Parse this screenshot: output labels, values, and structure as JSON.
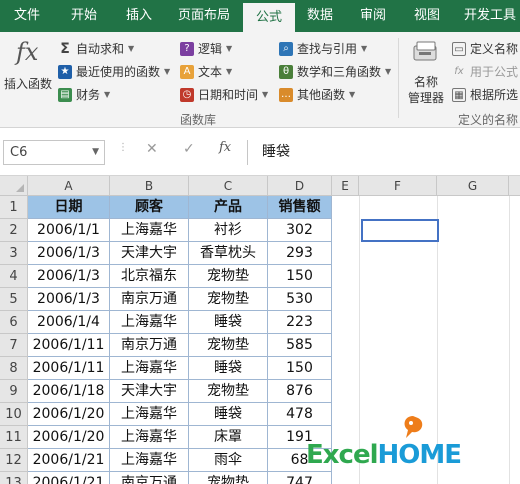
{
  "tabs": [
    {
      "label": "文件"
    },
    {
      "label": "开始"
    },
    {
      "label": "插入"
    },
    {
      "label": "页面布局"
    },
    {
      "label": "公式"
    },
    {
      "label": "数据"
    },
    {
      "label": "审阅"
    },
    {
      "label": "视图"
    },
    {
      "label": "开发工具"
    }
  ],
  "active_tab": "公式",
  "ribbon": {
    "insert_function": {
      "symbol": "fx",
      "label": "插入函数"
    },
    "autosum": "自动求和",
    "recently_used": "最近使用的函数",
    "financial": "财务",
    "logical": "逻辑",
    "text": "文本",
    "date_time": "日期和时间",
    "lookup_reference": "查找与引用",
    "math_trig": "数学和三角函数",
    "more_functions": "其他函数",
    "function_library_label": "函数库",
    "name_manager_line1": "名称",
    "name_manager_line2": "管理器",
    "define_name": "定义名称",
    "use_in_formula": "用于公式",
    "create_from_selection": "根据所选",
    "defined_names_label": "定义的名称"
  },
  "formula_bar": {
    "name_box": "C6",
    "fx_label": "fx",
    "cancel_icon": "✕",
    "enter_icon": "✓",
    "value": "睡袋"
  },
  "columns": [
    "A",
    "B",
    "C",
    "D",
    "E",
    "F",
    "G"
  ],
  "table": {
    "headers": [
      "日期",
      "顾客",
      "产品",
      "销售额"
    ],
    "rows": [
      {
        "row": "2",
        "date": "2006/1/1",
        "customer": "上海嘉华",
        "product": "衬衫",
        "sales": "302"
      },
      {
        "row": "3",
        "date": "2006/1/3",
        "customer": "天津大宇",
        "product": "香草枕头",
        "sales": "293"
      },
      {
        "row": "4",
        "date": "2006/1/3",
        "customer": "北京福东",
        "product": "宠物垫",
        "sales": "150"
      },
      {
        "row": "5",
        "date": "2006/1/3",
        "customer": "南京万通",
        "product": "宠物垫",
        "sales": "530"
      },
      {
        "row": "6",
        "date": "2006/1/4",
        "customer": "上海嘉华",
        "product": "睡袋",
        "sales": "223"
      },
      {
        "row": "7",
        "date": "2006/1/11",
        "customer": "南京万通",
        "product": "宠物垫",
        "sales": "585"
      },
      {
        "row": "8",
        "date": "2006/1/11",
        "customer": "上海嘉华",
        "product": "睡袋",
        "sales": "150"
      },
      {
        "row": "9",
        "date": "2006/1/18",
        "customer": "天津大宇",
        "product": "宠物垫",
        "sales": "876"
      },
      {
        "row": "10",
        "date": "2006/1/20",
        "customer": "上海嘉华",
        "product": "睡袋",
        "sales": "478"
      },
      {
        "row": "11",
        "date": "2006/1/20",
        "customer": "上海嘉华",
        "product": "床罩",
        "sales": "191"
      },
      {
        "row": "12",
        "date": "2006/1/21",
        "customer": "上海嘉华",
        "product": "雨伞",
        "sales": "68"
      },
      {
        "row": "13",
        "date": "2006/1/21",
        "customer": "南京万通",
        "product": "宠物垫",
        "sales": "747"
      }
    ]
  },
  "header_row_number": "1",
  "logo": {
    "part1": "Excel",
    "part2": "HOME"
  },
  "colors": {
    "excel_green": "#217346",
    "header_fill": "#9dc3e6",
    "selection": "#4472c4"
  }
}
